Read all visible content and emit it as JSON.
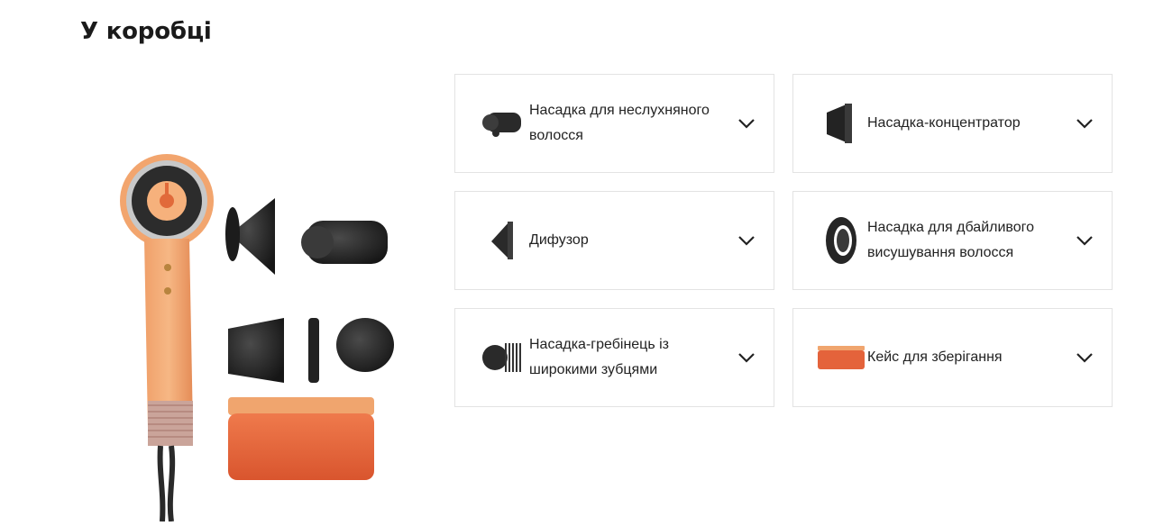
{
  "section": {
    "title": "У коробці"
  },
  "product_image": {
    "alt_name": "hair-dryer-set-image"
  },
  "items": [
    {
      "id": "frizz",
      "label": "Насадка для неслухняного волосся",
      "icon": "anti-frizz-attachment-icon"
    },
    {
      "id": "concentrator",
      "label": "Насадка-концентратор",
      "icon": "concentrator-attachment-icon"
    },
    {
      "id": "diffuser",
      "label": "Дифузор",
      "icon": "diffuser-attachment-icon"
    },
    {
      "id": "gentle",
      "label": "Насадка для дбайливого висушування волосся",
      "icon": "gentle-dryer-attachment-icon"
    },
    {
      "id": "comb",
      "label": "Насадка-гребінець із широкими зубцями",
      "icon": "wide-tooth-comb-icon"
    },
    {
      "id": "case",
      "label": "Кейс для зберігання",
      "icon": "storage-case-icon"
    }
  ],
  "colors": {
    "accent_orange": "#e8734a",
    "dryer_orange": "#f2a56e",
    "attachment_dark": "#2b2b2b"
  }
}
